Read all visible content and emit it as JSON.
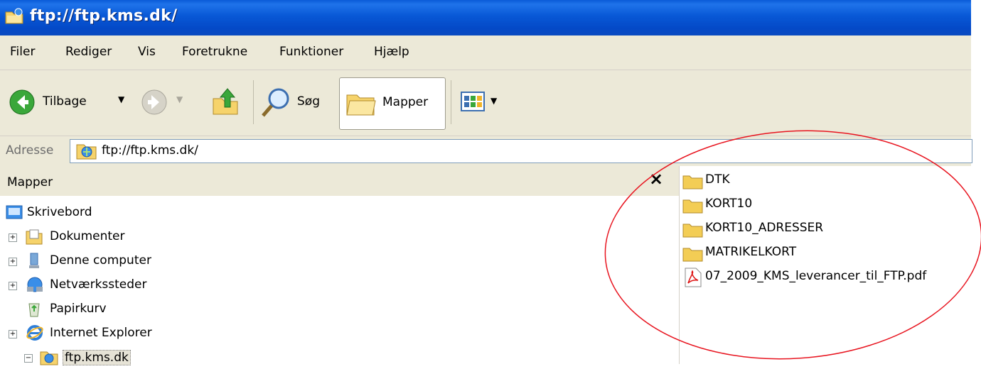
{
  "window": {
    "title": "ftp://ftp.kms.dk/"
  },
  "menu": [
    "Filer",
    "Rediger",
    "Vis",
    "Foretrukne",
    "Funktioner",
    "Hjælp"
  ],
  "toolbar": {
    "back_label": "Tilbage",
    "search_label": "Søg",
    "folders_label": "Mapper"
  },
  "address": {
    "label": "Adresse",
    "value": "ftp://ftp.kms.dk/"
  },
  "folders_pane": {
    "title": "Mapper",
    "close_glyph": "×",
    "items": [
      "Skrivebord",
      "Dokumenter",
      "Denne computer",
      "Netværkssteder",
      "Papirkurv",
      "Internet Explorer",
      "ftp.kms.dk"
    ]
  },
  "files": [
    "DTK",
    "KORT10",
    "KORT10_ADRESSER",
    "MATRIKELKORT",
    "07_2009_KMS_leverancer_til_FTP.pdf"
  ],
  "colors": {
    "titlebar": "#0a5bd8",
    "chrome": "#ece9d8",
    "annotation": "#e8141f"
  }
}
